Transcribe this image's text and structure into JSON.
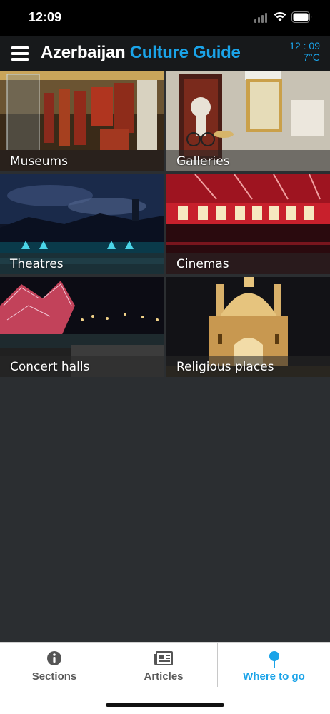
{
  "status_bar": {
    "time": "12:09",
    "icons": [
      "signal-icon",
      "wifi-icon",
      "battery-icon"
    ]
  },
  "header": {
    "title_part1": "Azerbaijan",
    "title_part2": "Culture Guide",
    "clock": "12 : 09",
    "temperature": "7°C",
    "accent_color": "#1aa3e8",
    "menu_icon": "menu-icon"
  },
  "sections": [
    {
      "label": "Museums"
    },
    {
      "label": "Galleries"
    },
    {
      "label": "Theatres"
    },
    {
      "label": "Cinemas"
    },
    {
      "label": "Concert halls"
    },
    {
      "label": "Religious places"
    }
  ],
  "tabs": [
    {
      "label": "Sections",
      "icon": "info-icon",
      "active": false
    },
    {
      "label": "Articles",
      "icon": "newspaper-icon",
      "active": false
    },
    {
      "label": "Where to go",
      "icon": "location-pin-icon",
      "active": true
    }
  ]
}
